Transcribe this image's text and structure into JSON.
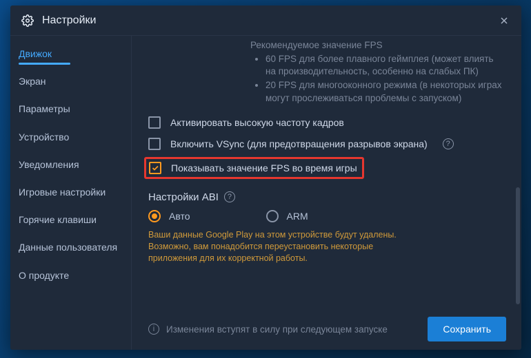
{
  "header": {
    "title": "Настройки"
  },
  "sidebar": {
    "items": [
      {
        "label": "Движок",
        "active": true
      },
      {
        "label": "Экран"
      },
      {
        "label": "Параметры"
      },
      {
        "label": "Устройство"
      },
      {
        "label": "Уведомления"
      },
      {
        "label": "Игровые настройки"
      },
      {
        "label": "Горячие клавиши"
      },
      {
        "label": "Данные пользователя"
      },
      {
        "label": "О продукте"
      }
    ]
  },
  "content": {
    "fps_recommend_title": "Рекомендуемое значение FPS",
    "fps_bullets": [
      "60 FPS для более плавного геймплея (может влиять на производительность, особенно на слабых ПК)",
      "20 FPS для многооконного режима (в некоторых играх могут прослеживаться проблемы с запуском)"
    ],
    "checkboxes": [
      {
        "label": "Активировать высокую частоту кадров",
        "checked": false
      },
      {
        "label": "Включить VSync (для предотвращения разрывов экрана)",
        "checked": false,
        "help": true
      },
      {
        "label": "Показывать значение FPS во время игры",
        "checked": true,
        "highlight": true
      }
    ],
    "abi": {
      "title": "Настройки ABI",
      "options": [
        {
          "label": "Авто",
          "selected": true
        },
        {
          "label": "ARM",
          "selected": false
        }
      ],
      "warning": "Ваши данные Google Play на этом устройстве будут удалены. Возможно, вам понадобится переустановить некоторые приложения для их корректной работы."
    }
  },
  "footer": {
    "notice": "Изменения вступят в силу при следующем запуске",
    "save_label": "Сохранить"
  },
  "colors": {
    "accent": "#44aaff",
    "highlight_orange": "#ff9a1f",
    "highlight_red": "#e6372f",
    "warning_text": "#d09a3a",
    "primary_button": "#1b7fd6"
  }
}
